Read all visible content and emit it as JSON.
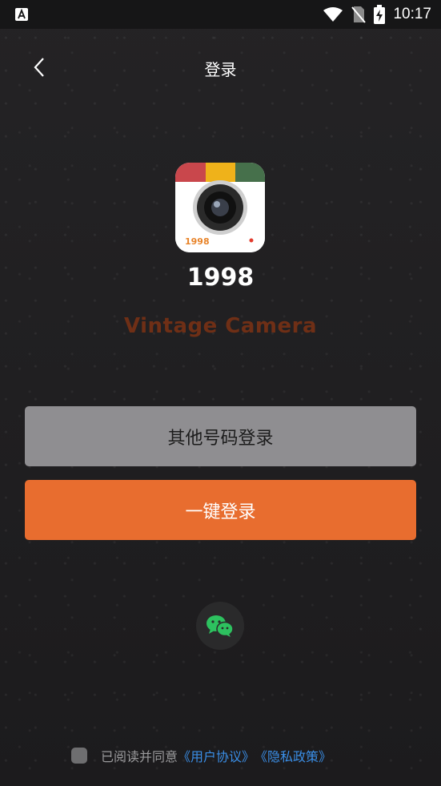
{
  "status_bar": {
    "time": "10:17"
  },
  "header": {
    "title": "登录"
  },
  "app": {
    "name": "1998",
    "tagline": "Vintage Camera",
    "logo_text": "1998"
  },
  "buttons": {
    "other_login": "其他号码登录",
    "one_key_login": "一键登录"
  },
  "agreement": {
    "text": "已阅读并同意",
    "user_agreement": "《用户协议》",
    "privacy_policy": "《隐私政策》"
  },
  "colors": {
    "accent": "#e86d2f",
    "secondary_button": "#8f8e91",
    "link": "#3a8ee6",
    "wechat_green": "#2dc15f"
  }
}
